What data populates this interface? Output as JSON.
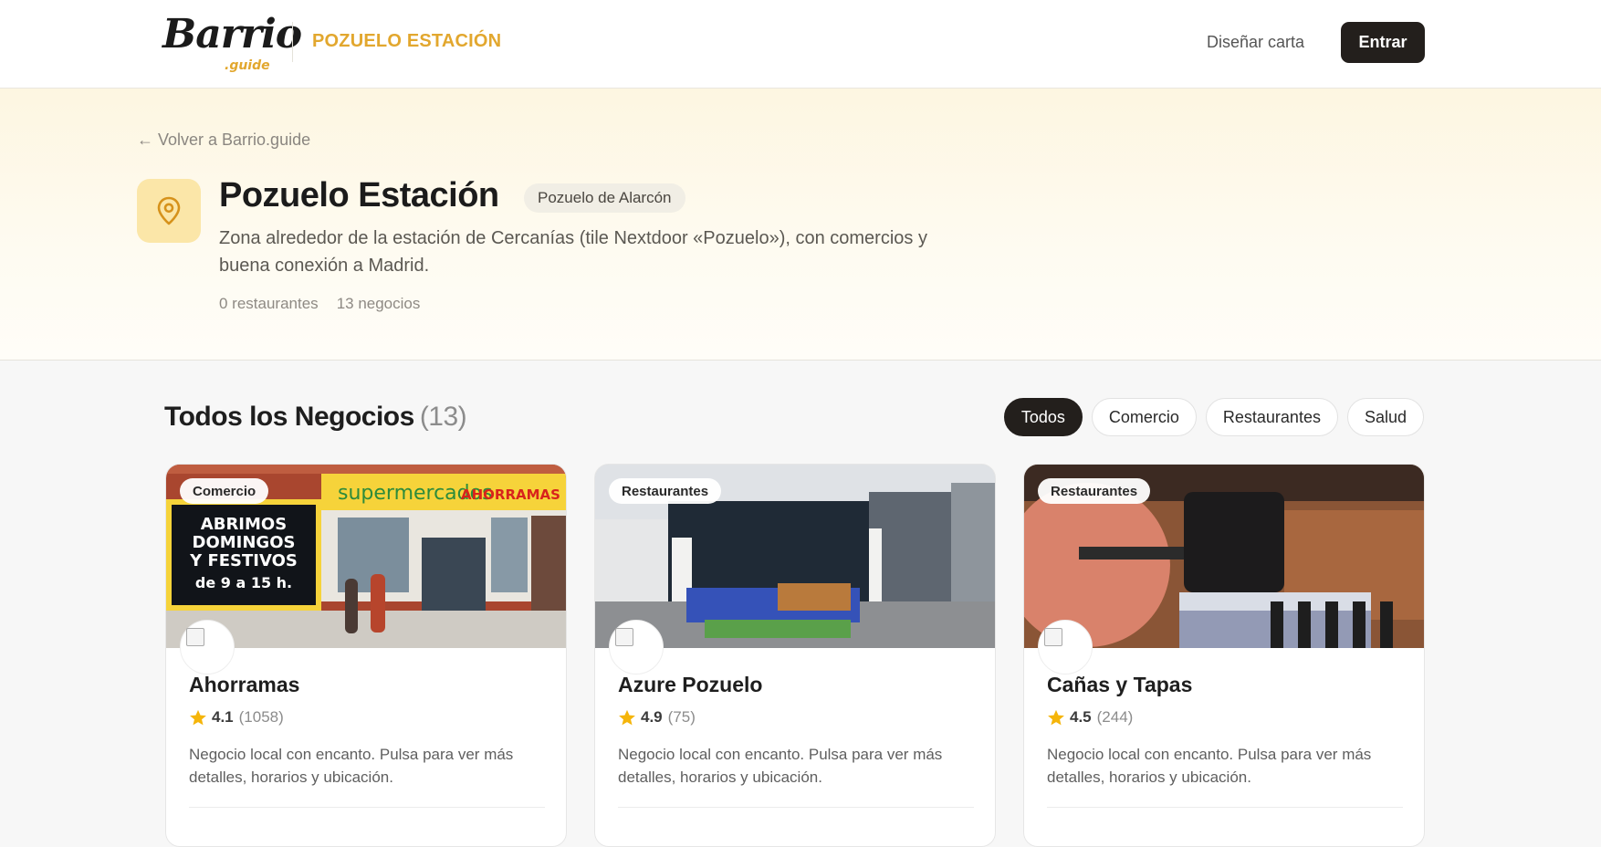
{
  "header": {
    "logo_text": "Barrio",
    "logo_sub": ".guide",
    "area_name": "POZUELO ESTACIÓN",
    "nav_link": "Diseñar carta",
    "login_label": "Entrar"
  },
  "hero": {
    "back_link": "← Volver a Barrio.guide",
    "icon": "map-pin-icon",
    "title": "Pozuelo Estación",
    "city_badge": "Pozuelo de Alarcón",
    "description": "Zona alrededor de la estación de Cercanías (tile Nextdoor «Pozuelo»), con comercios y buena conexión a Madrid.",
    "stats": {
      "restaurants": "0 restaurantes",
      "businesses": "13 negocios"
    }
  },
  "section": {
    "title": "Todos los Negocios",
    "count": "(13)",
    "filters": [
      "Todos",
      "Comercio",
      "Restaurantes",
      "Salud"
    ],
    "active_filter": "Todos"
  },
  "cards": [
    {
      "category": "Comercio",
      "name": "Ahorramas",
      "rating": "4.1",
      "reviews": "(1058)",
      "description": "Negocio local con encanto. Pulsa para ver más detalles, horarios y ubicación.",
      "photo_texts": {
        "sign": "supermercados",
        "brand": "AHORRAMAS",
        "poster": [
          "ABRIMOS",
          "DOMINGOS",
          "Y FESTIVOS",
          "de 9 a 15 h."
        ]
      }
    },
    {
      "category": "Restaurantes",
      "name": "Azure Pozuelo",
      "rating": "4.9",
      "reviews": "(75)",
      "description": "Negocio local con encanto. Pulsa para ver más detalles, horarios y ubicación."
    },
    {
      "category": "Restaurantes",
      "name": "Cañas y Tapas",
      "rating": "4.5",
      "reviews": "(244)",
      "description": "Negocio local con encanto. Pulsa para ver más detalles, horarios y ubicación."
    }
  ],
  "colors": {
    "accent": "#e2a72e",
    "dark": "#231f1c",
    "star": "#f5b50a"
  }
}
